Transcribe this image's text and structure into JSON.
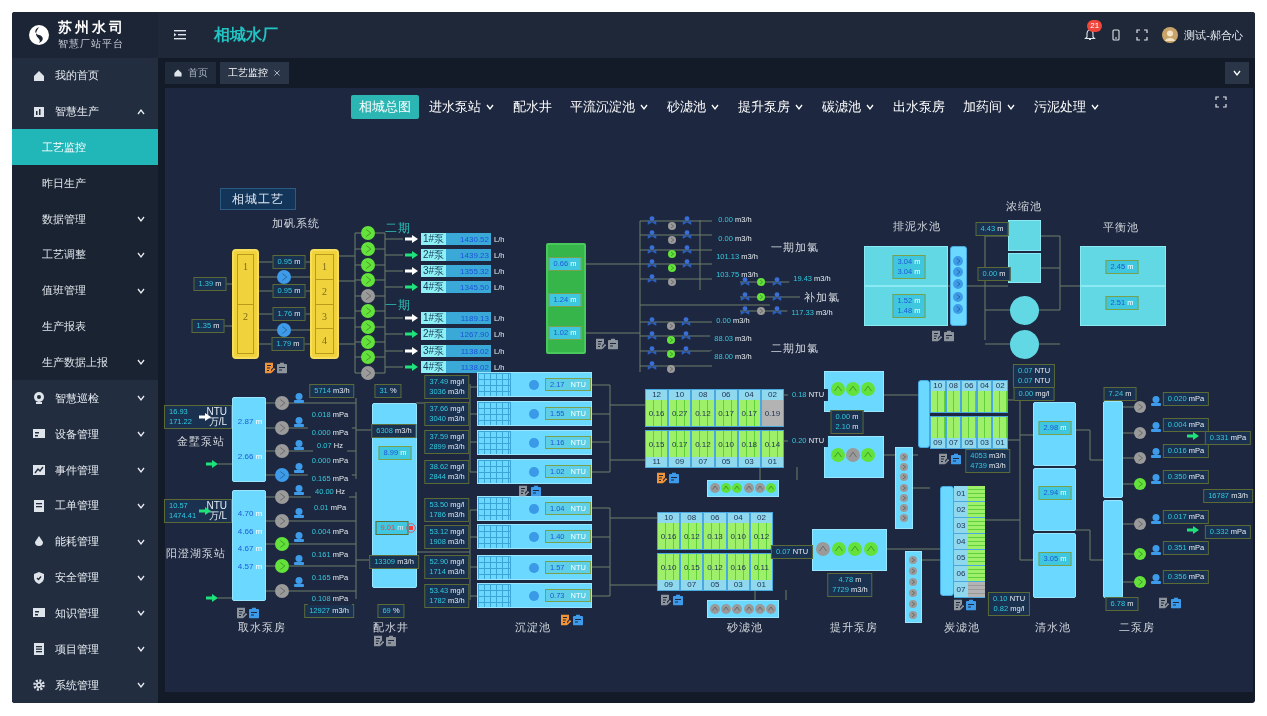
{
  "brand": {
    "name": "苏州水司",
    "subtitle": "智慧厂站平台"
  },
  "sidebar": {
    "items": [
      {
        "label": "我的首页",
        "expandable": false
      },
      {
        "label": "智慧生产",
        "expandable": true,
        "expanded": true,
        "children": [
          {
            "label": "工艺监控",
            "expandable": false,
            "selected": true
          },
          {
            "label": "昨日生产",
            "expandable": false,
            "selected": false
          },
          {
            "label": "数据管理",
            "expandable": true,
            "selected": false
          },
          {
            "label": "工艺调整",
            "expandable": true,
            "selected": false
          },
          {
            "label": "值班管理",
            "expandable": true,
            "selected": false
          },
          {
            "label": "生产报表",
            "expandable": false,
            "selected": false
          },
          {
            "label": "生产数据上报",
            "expandable": true,
            "selected": false
          }
        ]
      },
      {
        "label": "智慧巡检",
        "expandable": true,
        "expanded": false
      },
      {
        "label": "设备管理",
        "expandable": true,
        "expanded": false
      },
      {
        "label": "事件管理",
        "expandable": true,
        "expanded": false
      },
      {
        "label": "工单管理",
        "expandable": true,
        "expanded": false
      },
      {
        "label": "能耗管理",
        "expandable": true,
        "expanded": false
      },
      {
        "label": "安全管理",
        "expandable": true,
        "expanded": false
      },
      {
        "label": "知识管理",
        "expandable": true,
        "expanded": false
      },
      {
        "label": "项目管理",
        "expandable": true,
        "expanded": false
      },
      {
        "label": "系统管理",
        "expandable": true,
        "expanded": false
      }
    ]
  },
  "header": {
    "title": "相城水厂",
    "notifications": "21",
    "user": "测试-郝合心"
  },
  "page_tabs": [
    {
      "label": "首页",
      "selected": false,
      "closable": false
    },
    {
      "label": "工艺监控",
      "selected": true,
      "closable": true
    }
  ],
  "nav": [
    {
      "label": "相城总图",
      "selected": true,
      "dropdown": false
    },
    {
      "label": "进水泵站",
      "selected": false,
      "dropdown": true
    },
    {
      "label": "配水井",
      "selected": false,
      "dropdown": false
    },
    {
      "label": "平流沉淀池",
      "selected": false,
      "dropdown": true
    },
    {
      "label": "砂滤池",
      "selected": false,
      "dropdown": true
    },
    {
      "label": "提升泵房",
      "selected": false,
      "dropdown": true
    },
    {
      "label": "碳滤池",
      "selected": false,
      "dropdown": true
    },
    {
      "label": "出水泵房",
      "selected": false,
      "dropdown": false
    },
    {
      "label": "加药间",
      "selected": false,
      "dropdown": true
    },
    {
      "label": "污泥处理",
      "selected": false,
      "dropdown": true
    }
  ],
  "diagram": {
    "title": "相城工艺",
    "labels": [
      {
        "text": "加矾系统",
        "kind": "section"
      },
      {
        "text": "二期",
        "kind": "phase"
      },
      {
        "text": "一期",
        "kind": "phase"
      },
      {
        "text": "一期加氯",
        "kind": "section"
      },
      {
        "text": "补加氯",
        "kind": "section"
      },
      {
        "text": "二期加氯",
        "kind": "section"
      },
      {
        "text": "排泥水池",
        "kind": "section"
      },
      {
        "text": "浓缩池",
        "kind": "section"
      },
      {
        "text": "平衡池",
        "kind": "section"
      },
      {
        "text": "金墅泵站",
        "kind": "section"
      },
      {
        "text": "阳澄湖泵站",
        "kind": "section"
      },
      {
        "text": "取水泵房",
        "kind": "section"
      },
      {
        "text": "配水井",
        "kind": "section"
      },
      {
        "text": "沉淀池",
        "kind": "section"
      },
      {
        "text": "砂滤池",
        "kind": "section"
      },
      {
        "text": "提升泵房",
        "kind": "section"
      },
      {
        "text": "炭滤池",
        "kind": "section"
      },
      {
        "text": "清水池",
        "kind": "section"
      },
      {
        "text": "二泵房",
        "kind": "section"
      }
    ],
    "alum_tanks": [
      {
        "sections": [
          "1",
          "2"
        ]
      },
      {
        "sections": [
          "1",
          "2",
          "3",
          "4"
        ]
      }
    ],
    "dosing": [
      {
        "pump": "1#泵",
        "value": "1430.52",
        "unit": "L/h",
        "active": false
      },
      {
        "pump": "2#泵",
        "value": "1439.23",
        "unit": "L/h",
        "active": true
      },
      {
        "pump": "3#泵",
        "value": "1355.32",
        "unit": "L/h",
        "active": false
      },
      {
        "pump": "4#泵",
        "value": "1345.50",
        "unit": "L/h",
        "active": true
      },
      {
        "pump": "1#泵",
        "value": "1189.13",
        "unit": "L/h",
        "active": false
      },
      {
        "pump": "2#泵",
        "value": "1267.90",
        "unit": "L/h",
        "active": true
      },
      {
        "pump": "3#泵",
        "value": "1138.02",
        "unit": "L/h",
        "active": false
      },
      {
        "pump": "4#泵",
        "value": "1138.02",
        "unit": "L/h",
        "active": true
      }
    ],
    "readouts": [
      {
        "kind": "boxed",
        "lines": [
          {
            "value": "1.39",
            "unit": "m"
          }
        ]
      },
      {
        "kind": "boxed",
        "lines": [
          {
            "value": "1.35",
            "unit": "m"
          }
        ]
      },
      {
        "kind": "boxed",
        "lines": [
          {
            "value": "0.95",
            "unit": "m"
          }
        ]
      },
      {
        "kind": "boxed",
        "lines": [
          {
            "value": "0.95",
            "unit": "m"
          }
        ]
      },
      {
        "kind": "boxed",
        "lines": [
          {
            "value": "1.76",
            "unit": "m"
          }
        ]
      },
      {
        "kind": "boxed",
        "lines": [
          {
            "value": "1.79",
            "unit": "m"
          }
        ]
      },
      {
        "kind": "inner",
        "lines": [
          {
            "value": "0.66",
            "unit": "m"
          }
        ]
      },
      {
        "kind": "inner",
        "lines": [
          {
            "value": "1.24",
            "unit": "m"
          }
        ]
      },
      {
        "kind": "inner",
        "lines": [
          {
            "value": "1.02",
            "unit": "m"
          }
        ]
      },
      {
        "kind": "inner",
        "lines": [
          {
            "value": "3.04",
            "unit": "m"
          },
          {
            "value": "3.04",
            "unit": "m"
          }
        ]
      },
      {
        "kind": "inner",
        "lines": [
          {
            "value": "1.52",
            "unit": "m"
          },
          {
            "value": "1.48",
            "unit": "m"
          }
        ]
      },
      {
        "kind": "boxed",
        "lines": [
          {
            "value": "4.43",
            "unit": "m"
          }
        ]
      },
      {
        "kind": "boxed",
        "lines": [
          {
            "value": "0.00",
            "unit": "m"
          }
        ]
      },
      {
        "kind": "inner",
        "lines": [
          {
            "value": "2.45",
            "unit": "m"
          }
        ]
      },
      {
        "kind": "inner",
        "lines": [
          {
            "value": "2.51",
            "unit": "m"
          }
        ]
      },
      {
        "kind": "boxed",
        "lines": [
          {
            "value": "16.93",
            "unit": "NTU"
          },
          {
            "value": "171.22",
            "unit": "万/L"
          }
        ]
      },
      {
        "kind": "boxed",
        "lines": [
          {
            "value": "10.57",
            "unit": "NTU"
          },
          {
            "value": "1474.41",
            "unit": "万/L"
          }
        ]
      },
      {
        "kind": "level",
        "lines": [
          {
            "value": "2.87",
            "unit": "m"
          }
        ]
      },
      {
        "kind": "level",
        "lines": [
          {
            "value": "2.66",
            "unit": "m"
          }
        ]
      },
      {
        "kind": "level",
        "lines": [
          {
            "value": "4.70",
            "unit": "m"
          }
        ]
      },
      {
        "kind": "level",
        "lines": [
          {
            "value": "4.66",
            "unit": "m"
          }
        ]
      },
      {
        "kind": "level",
        "lines": [
          {
            "value": "4.67",
            "unit": "m"
          }
        ]
      },
      {
        "kind": "level",
        "lines": [
          {
            "value": "4.57",
            "unit": "m"
          }
        ]
      },
      {
        "kind": "boxed",
        "lines": [
          {
            "value": "5714",
            "unit": "m3/h"
          }
        ]
      },
      {
        "kind": "boxed",
        "lines": [
          {
            "value": "31",
            "unit": "%"
          }
        ]
      },
      {
        "kind": "boxed",
        "lines": [
          {
            "value": "6308",
            "unit": "m3/h"
          }
        ]
      },
      {
        "kind": "inner",
        "lines": [
          {
            "value": "8.99",
            "unit": "m"
          }
        ]
      },
      {
        "kind": "alarm",
        "lines": [
          {
            "value": "9.01",
            "unit": "m"
          }
        ]
      },
      {
        "kind": "boxed",
        "lines": [
          {
            "value": "13309",
            "unit": "m3/h"
          }
        ]
      },
      {
        "kind": "boxed",
        "lines": [
          {
            "value": "12927",
            "unit": "m3/h"
          }
        ]
      },
      {
        "kind": "boxed",
        "lines": [
          {
            "value": "69",
            "unit": "%"
          }
        ]
      },
      {
        "kind": "boxed",
        "lines": [
          {
            "value": "37.49",
            "unit": "mg/l"
          },
          {
            "value": "3036",
            "unit": "m3/h"
          }
        ]
      },
      {
        "kind": "boxed",
        "lines": [
          {
            "value": "37.66",
            "unit": "mg/l"
          },
          {
            "value": "3040",
            "unit": "m3/h"
          }
        ]
      },
      {
        "kind": "boxed",
        "lines": [
          {
            "value": "37.59",
            "unit": "mg/l"
          },
          {
            "value": "2899",
            "unit": "m3/h"
          }
        ]
      },
      {
        "kind": "boxed",
        "lines": [
          {
            "value": "38.62",
            "unit": "mg/l"
          },
          {
            "value": "2844",
            "unit": "m3/h"
          }
        ]
      },
      {
        "kind": "boxed",
        "lines": [
          {
            "value": "53.50",
            "unit": "mg/l"
          },
          {
            "value": "1786",
            "unit": "m3/h"
          }
        ]
      },
      {
        "kind": "boxed",
        "lines": [
          {
            "value": "53.12",
            "unit": "mg/l"
          },
          {
            "value": "1908",
            "unit": "m3/h"
          }
        ]
      },
      {
        "kind": "boxed",
        "lines": [
          {
            "value": "52.90",
            "unit": "mg/l"
          },
          {
            "value": "1714",
            "unit": "m3/h"
          }
        ]
      },
      {
        "kind": "boxed",
        "lines": [
          {
            "value": "53.43",
            "unit": "mg/l"
          },
          {
            "value": "1782",
            "unit": "m3/h"
          }
        ]
      },
      {
        "kind": "plain",
        "lines": [
          {
            "value": "0.18",
            "unit": "NTU"
          }
        ]
      },
      {
        "kind": "plain",
        "lines": [
          {
            "value": "0.20",
            "unit": "NTU"
          }
        ]
      },
      {
        "kind": "boxed",
        "lines": [
          {
            "value": "0.00",
            "unit": "m"
          },
          {
            "value": "2.10",
            "unit": "m"
          }
        ]
      },
      {
        "kind": "boxed",
        "lines": [
          {
            "value": "0.07",
            "unit": "NTU"
          }
        ]
      },
      {
        "kind": "boxed",
        "lines": [
          {
            "value": "4.78",
            "unit": "m"
          },
          {
            "value": "7729",
            "unit": "m3/h"
          }
        ]
      },
      {
        "kind": "boxed",
        "lines": [
          {
            "value": "0.07",
            "unit": "NTU"
          },
          {
            "value": "0.07",
            "unit": "NTU"
          }
        ]
      },
      {
        "kind": "boxed",
        "lines": [
          {
            "value": "0.00",
            "unit": "mg/l"
          }
        ]
      },
      {
        "kind": "boxed",
        "lines": [
          {
            "value": "4053",
            "unit": "m3/h"
          },
          {
            "value": "4739",
            "unit": "m3/h"
          }
        ]
      },
      {
        "kind": "boxed",
        "lines": [
          {
            "value": "0.10",
            "unit": "NTU"
          },
          {
            "value": "0.82",
            "unit": "mg/l"
          }
        ]
      },
      {
        "kind": "inner",
        "lines": [
          {
            "value": "2.98",
            "unit": "m"
          }
        ]
      },
      {
        "kind": "inner",
        "lines": [
          {
            "value": "2.94",
            "unit": "m"
          }
        ]
      },
      {
        "kind": "inner",
        "lines": [
          {
            "value": "3.05",
            "unit": "m"
          }
        ]
      },
      {
        "kind": "boxed",
        "lines": [
          {
            "value": "7.24",
            "unit": "m"
          }
        ]
      },
      {
        "kind": "boxed",
        "lines": [
          {
            "value": "6.78",
            "unit": "m"
          }
        ]
      },
      {
        "kind": "boxed",
        "lines": [
          {
            "value": "0.020",
            "unit": "mPa"
          }
        ]
      },
      {
        "kind": "boxed",
        "lines": [
          {
            "value": "0.004",
            "unit": "mPa"
          }
        ]
      },
      {
        "kind": "boxed",
        "lines": [
          {
            "value": "0.016",
            "unit": "mPa"
          }
        ]
      },
      {
        "kind": "boxed",
        "lines": [
          {
            "value": "0.350",
            "unit": "mPa"
          }
        ]
      },
      {
        "kind": "boxed",
        "lines": [
          {
            "value": "0.017",
            "unit": "mPa"
          }
        ]
      },
      {
        "kind": "boxed",
        "lines": [
          {
            "value": "0.351",
            "unit": "mPa"
          }
        ]
      },
      {
        "kind": "boxed",
        "lines": [
          {
            "value": "0.356",
            "unit": "mPa"
          }
        ]
      },
      {
        "kind": "boxed",
        "lines": [
          {
            "value": "0.331",
            "unit": "mPa"
          }
        ]
      },
      {
        "kind": "boxed",
        "lines": [
          {
            "value": "16787",
            "unit": "m3/h"
          }
        ]
      },
      {
        "kind": "boxed",
        "lines": [
          {
            "value": "0.332",
            "unit": "mPa"
          }
        ]
      },
      {
        "kind": "plain",
        "lines": [
          {
            "value": "0.00",
            "unit": "m3/h"
          }
        ]
      },
      {
        "kind": "plain",
        "lines": [
          {
            "value": "0.00",
            "unit": "m3/h"
          }
        ]
      },
      {
        "kind": "plain",
        "lines": [
          {
            "value": "101.13",
            "unit": "m3/h"
          }
        ]
      },
      {
        "kind": "plain",
        "lines": [
          {
            "value": "103.75",
            "unit": "m3/h"
          }
        ]
      },
      {
        "kind": "plain",
        "lines": [
          {
            "value": "19.43",
            "unit": "m3/h"
          }
        ]
      },
      {
        "kind": "plain",
        "lines": [
          {
            "value": "117.33",
            "unit": "m3/h"
          }
        ]
      },
      {
        "kind": "plain",
        "lines": [
          {
            "value": "0.00",
            "unit": "m3/h"
          }
        ]
      },
      {
        "kind": "plain",
        "lines": [
          {
            "value": "88.03",
            "unit": "m3/h"
          }
        ]
      },
      {
        "kind": "plain",
        "lines": [
          {
            "value": "88.00",
            "unit": "m3/h"
          }
        ]
      },
      {
        "kind": "plain",
        "lines": [
          {
            "value": "0.018",
            "unit": "mPa"
          }
        ]
      },
      {
        "kind": "plain",
        "lines": [
          {
            "value": "0.000",
            "unit": "mPa"
          }
        ]
      },
      {
        "kind": "plain",
        "lines": [
          {
            "value": "0.07",
            "unit": "Hz"
          }
        ]
      },
      {
        "kind": "plain",
        "lines": [
          {
            "value": "0.000",
            "unit": "mPa"
          }
        ]
      },
      {
        "kind": "plain",
        "lines": [
          {
            "value": "0.165",
            "unit": "mPa"
          }
        ]
      },
      {
        "kind": "plain",
        "lines": [
          {
            "value": "40.00",
            "unit": "Hz"
          }
        ]
      },
      {
        "kind": "plain",
        "lines": [
          {
            "value": "0.01",
            "unit": "mPa"
          }
        ]
      },
      {
        "kind": "plain",
        "lines": [
          {
            "value": "0.004",
            "unit": "mPa"
          }
        ]
      },
      {
        "kind": "plain",
        "lines": [
          {
            "value": "0.161",
            "unit": "mPa"
          }
        ]
      },
      {
        "kind": "plain",
        "lines": [
          {
            "value": "0.165",
            "unit": "mPa"
          }
        ]
      },
      {
        "kind": "plain",
        "lines": [
          {
            "value": "0.108",
            "unit": "mPa"
          }
        ]
      }
    ],
    "pump_groups": [
      {
        "pumps": [
          {
            "running": true
          },
          {
            "running": true
          },
          {
            "running": true
          },
          {
            "running": true
          },
          {
            "running": false
          },
          {
            "running": true
          },
          {
            "running": true
          },
          {
            "running": true
          },
          {
            "running": true
          },
          {
            "running": false
          }
        ]
      },
      {
        "pumps": [
          {
            "running": false,
            "standby": true
          },
          {
            "running": false,
            "standby": true
          }
        ]
      },
      {
        "pumps": [
          {
            "running": false
          },
          {
            "running": false
          },
          {
            "running": true
          },
          {
            "running": true
          },
          {
            "running": false
          }
        ]
      },
      {
        "pumps": [
          {
            "running": true
          },
          {
            "running": true
          },
          {
            "running": false
          }
        ]
      },
      {
        "pumps": [
          {
            "running": false
          },
          {
            "running": true
          },
          {
            "running": true
          },
          {
            "running": false
          }
        ]
      },
      {
        "pumps": [
          {
            "running": false,
            "standby": true
          },
          {
            "running": false,
            "standby": true
          },
          {
            "running": false,
            "standby": true
          },
          {
            "running": false,
            "standby": true
          },
          {
            "running": false,
            "standby": true
          }
        ]
      },
      {
        "pumps": [
          {
            "running": false,
            "standby": false
          },
          {
            "running": false,
            "standby": false
          },
          {
            "running": false,
            "standby": false
          },
          {
            "running": false,
            "standby": true
          },
          {
            "running": false,
            "standby": false
          },
          {
            "running": false,
            "standby": false
          },
          {
            "running": true,
            "standby": false
          },
          {
            "running": true,
            "standby": false
          },
          {
            "running": false,
            "standby": false
          }
        ]
      },
      {
        "pumps": [
          {
            "running": false
          },
          {
            "running": true
          },
          {
            "running": true
          },
          {
            "running": false
          },
          {
            "running": false
          },
          {
            "running": true
          }
        ]
      },
      {
        "pumps": [
          {
            "running": false
          },
          {
            "running": false
          },
          {
            "running": false
          },
          {
            "running": false
          },
          {
            "running": false
          },
          {
            "running": false
          }
        ]
      },
      {
        "pumps": [
          {
            "running": true
          },
          {
            "running": true
          },
          {
            "running": true
          }
        ]
      },
      {
        "pumps": [
          {
            "running": true
          },
          {
            "running": false
          },
          {
            "running": true
          }
        ]
      },
      {
        "pumps": [
          {
            "running": false
          },
          {
            "running": true
          },
          {
            "running": true
          },
          {
            "running": true
          }
        ]
      },
      {
        "pumps": [
          {
            "running": false
          },
          {
            "running": false
          },
          {
            "running": false
          },
          {
            "running": false
          },
          {
            "running": false
          },
          {
            "running": false
          },
          {
            "running": false
          }
        ]
      },
      {
        "pumps": [
          {
            "running": false
          },
          {
            "running": false
          },
          {
            "running": false
          },
          {
            "running": false
          },
          {
            "running": false
          },
          {
            "running": false
          }
        ]
      },
      {
        "pumps": [
          {
            "running": false
          },
          {
            "running": false
          },
          {
            "running": false
          },
          {
            "running": true
          },
          {
            "running": false
          },
          {
            "running": true
          },
          {
            "running": true
          }
        ]
      }
    ],
    "arrows": [
      {
        "active": false
      },
      {
        "active": true
      },
      {
        "active": true
      },
      {
        "active": true
      },
      {
        "active": true
      },
      {
        "active": true
      }
    ],
    "sed_tanks": [
      {
        "value": "2.17",
        "unit": "NTU"
      },
      {
        "value": "1.55",
        "unit": "NTU"
      },
      {
        "value": "1.16",
        "unit": "NTU"
      },
      {
        "value": "1.02",
        "unit": "NTU"
      },
      {
        "value": "1.04",
        "unit": "NTU"
      },
      {
        "value": "1.40",
        "unit": "NTU"
      },
      {
        "value": "1.57",
        "unit": "NTU"
      },
      {
        "value": "0.73",
        "unit": "NTU"
      }
    ],
    "sand_filters": [
      {
        "top": [
          {
            "id": "12",
            "value": "0.16",
            "running": true
          },
          {
            "id": "10",
            "value": "0.27",
            "running": true
          },
          {
            "id": "08",
            "value": "0.12",
            "running": true
          },
          {
            "id": "06",
            "value": "0.17",
            "running": true
          },
          {
            "id": "04",
            "value": "0.17",
            "running": true
          },
          {
            "id": "02",
            "value": "0.19",
            "running": false
          }
        ],
        "bottom": [
          {
            "id": "11",
            "value": "0.15",
            "running": true
          },
          {
            "id": "09",
            "value": "0.17",
            "running": true
          },
          {
            "id": "07",
            "value": "0.12",
            "running": true
          },
          {
            "id": "05",
            "value": "0.10",
            "running": true
          },
          {
            "id": "03",
            "value": "0.18",
            "running": true
          },
          {
            "id": "01",
            "value": "0.14",
            "running": true
          }
        ]
      },
      {
        "top": [
          {
            "id": "10",
            "value": "0.16",
            "running": true
          },
          {
            "id": "08",
            "value": "0.12",
            "running": true
          },
          {
            "id": "06",
            "value": "0.13",
            "running": true
          },
          {
            "id": "04",
            "value": "0.10",
            "running": true
          },
          {
            "id": "02",
            "value": "0.12",
            "running": true
          }
        ],
        "bottom": [
          {
            "id": "09",
            "value": "0.10",
            "running": true
          },
          {
            "id": "07",
            "value": "0.15",
            "running": true
          },
          {
            "id": "05",
            "value": "0.12",
            "running": true
          },
          {
            "id": "03",
            "value": "0.16",
            "running": true
          },
          {
            "id": "01",
            "value": "0.11",
            "running": true
          }
        ]
      }
    ],
    "carbon_filters": [
      {
        "kind": "grid",
        "top": [
          {
            "id": "10",
            "running": true
          },
          {
            "id": "08",
            "running": true
          },
          {
            "id": "06",
            "running": true
          },
          {
            "id": "04",
            "running": true
          },
          {
            "id": "02",
            "running": true
          }
        ],
        "bottom": [
          {
            "id": "09",
            "running": true
          },
          {
            "id": "07",
            "running": true
          },
          {
            "id": "05",
            "running": true
          },
          {
            "id": "03",
            "running": true
          },
          {
            "id": "01",
            "running": true
          }
        ]
      },
      {
        "kind": "rows",
        "rows": [
          {
            "id": "01",
            "running": true
          },
          {
            "id": "02",
            "running": true
          },
          {
            "id": "03",
            "running": true
          },
          {
            "id": "04",
            "running": true
          },
          {
            "id": "05",
            "running": true
          },
          {
            "id": "06",
            "running": true
          },
          {
            "id": "07",
            "running": false
          }
        ]
      }
    ],
    "doc_icons": [
      {
        "report": true,
        "log": false
      },
      {
        "report": false,
        "log": true
      },
      {
        "report": false,
        "log": false
      },
      {
        "report": false,
        "log": true
      },
      {
        "report": true,
        "log": true
      },
      {
        "report": true,
        "log": true
      },
      {
        "report": false,
        "log": true
      },
      {
        "report": false,
        "log": false
      },
      {
        "report": false,
        "log": false
      },
      {
        "report": false,
        "log": true
      },
      {
        "report": false,
        "log": true
      },
      {
        "report": false,
        "log": true
      }
    ]
  }
}
